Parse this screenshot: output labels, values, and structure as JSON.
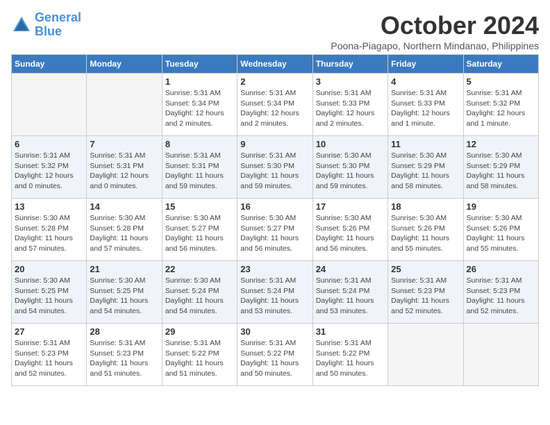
{
  "logo": {
    "line1": "General",
    "line2": "Blue"
  },
  "title": "October 2024",
  "subtitle": "Poona-Piagapo, Northern Mindanao, Philippines",
  "days_of_week": [
    "Sunday",
    "Monday",
    "Tuesday",
    "Wednesday",
    "Thursday",
    "Friday",
    "Saturday"
  ],
  "weeks": [
    [
      {
        "day": "",
        "info": ""
      },
      {
        "day": "",
        "info": ""
      },
      {
        "day": "1",
        "info": "Sunrise: 5:31 AM\nSunset: 5:34 PM\nDaylight: 12 hours and 2 minutes."
      },
      {
        "day": "2",
        "info": "Sunrise: 5:31 AM\nSunset: 5:34 PM\nDaylight: 12 hours and 2 minutes."
      },
      {
        "day": "3",
        "info": "Sunrise: 5:31 AM\nSunset: 5:33 PM\nDaylight: 12 hours and 2 minutes."
      },
      {
        "day": "4",
        "info": "Sunrise: 5:31 AM\nSunset: 5:33 PM\nDaylight: 12 hours and 1 minute."
      },
      {
        "day": "5",
        "info": "Sunrise: 5:31 AM\nSunset: 5:32 PM\nDaylight: 12 hours and 1 minute."
      }
    ],
    [
      {
        "day": "6",
        "info": "Sunrise: 5:31 AM\nSunset: 5:32 PM\nDaylight: 12 hours and 0 minutes."
      },
      {
        "day": "7",
        "info": "Sunrise: 5:31 AM\nSunset: 5:31 PM\nDaylight: 12 hours and 0 minutes."
      },
      {
        "day": "8",
        "info": "Sunrise: 5:31 AM\nSunset: 5:31 PM\nDaylight: 11 hours and 59 minutes."
      },
      {
        "day": "9",
        "info": "Sunrise: 5:31 AM\nSunset: 5:30 PM\nDaylight: 11 hours and 59 minutes."
      },
      {
        "day": "10",
        "info": "Sunrise: 5:30 AM\nSunset: 5:30 PM\nDaylight: 11 hours and 59 minutes."
      },
      {
        "day": "11",
        "info": "Sunrise: 5:30 AM\nSunset: 5:29 PM\nDaylight: 11 hours and 58 minutes."
      },
      {
        "day": "12",
        "info": "Sunrise: 5:30 AM\nSunset: 5:29 PM\nDaylight: 11 hours and 58 minutes."
      }
    ],
    [
      {
        "day": "13",
        "info": "Sunrise: 5:30 AM\nSunset: 5:28 PM\nDaylight: 11 hours and 57 minutes."
      },
      {
        "day": "14",
        "info": "Sunrise: 5:30 AM\nSunset: 5:28 PM\nDaylight: 11 hours and 57 minutes."
      },
      {
        "day": "15",
        "info": "Sunrise: 5:30 AM\nSunset: 5:27 PM\nDaylight: 11 hours and 56 minutes."
      },
      {
        "day": "16",
        "info": "Sunrise: 5:30 AM\nSunset: 5:27 PM\nDaylight: 11 hours and 56 minutes."
      },
      {
        "day": "17",
        "info": "Sunrise: 5:30 AM\nSunset: 5:26 PM\nDaylight: 11 hours and 56 minutes."
      },
      {
        "day": "18",
        "info": "Sunrise: 5:30 AM\nSunset: 5:26 PM\nDaylight: 11 hours and 55 minutes."
      },
      {
        "day": "19",
        "info": "Sunrise: 5:30 AM\nSunset: 5:26 PM\nDaylight: 11 hours and 55 minutes."
      }
    ],
    [
      {
        "day": "20",
        "info": "Sunrise: 5:30 AM\nSunset: 5:25 PM\nDaylight: 11 hours and 54 minutes."
      },
      {
        "day": "21",
        "info": "Sunrise: 5:30 AM\nSunset: 5:25 PM\nDaylight: 11 hours and 54 minutes."
      },
      {
        "day": "22",
        "info": "Sunrise: 5:30 AM\nSunset: 5:24 PM\nDaylight: 11 hours and 54 minutes."
      },
      {
        "day": "23",
        "info": "Sunrise: 5:31 AM\nSunset: 5:24 PM\nDaylight: 11 hours and 53 minutes."
      },
      {
        "day": "24",
        "info": "Sunrise: 5:31 AM\nSunset: 5:24 PM\nDaylight: 11 hours and 53 minutes."
      },
      {
        "day": "25",
        "info": "Sunrise: 5:31 AM\nSunset: 5:23 PM\nDaylight: 11 hours and 52 minutes."
      },
      {
        "day": "26",
        "info": "Sunrise: 5:31 AM\nSunset: 5:23 PM\nDaylight: 11 hours and 52 minutes."
      }
    ],
    [
      {
        "day": "27",
        "info": "Sunrise: 5:31 AM\nSunset: 5:23 PM\nDaylight: 11 hours and 52 minutes."
      },
      {
        "day": "28",
        "info": "Sunrise: 5:31 AM\nSunset: 5:23 PM\nDaylight: 11 hours and 51 minutes."
      },
      {
        "day": "29",
        "info": "Sunrise: 5:31 AM\nSunset: 5:22 PM\nDaylight: 11 hours and 51 minutes."
      },
      {
        "day": "30",
        "info": "Sunrise: 5:31 AM\nSunset: 5:22 PM\nDaylight: 11 hours and 50 minutes."
      },
      {
        "day": "31",
        "info": "Sunrise: 5:31 AM\nSunset: 5:22 PM\nDaylight: 11 hours and 50 minutes."
      },
      {
        "day": "",
        "info": ""
      },
      {
        "day": "",
        "info": ""
      }
    ]
  ]
}
